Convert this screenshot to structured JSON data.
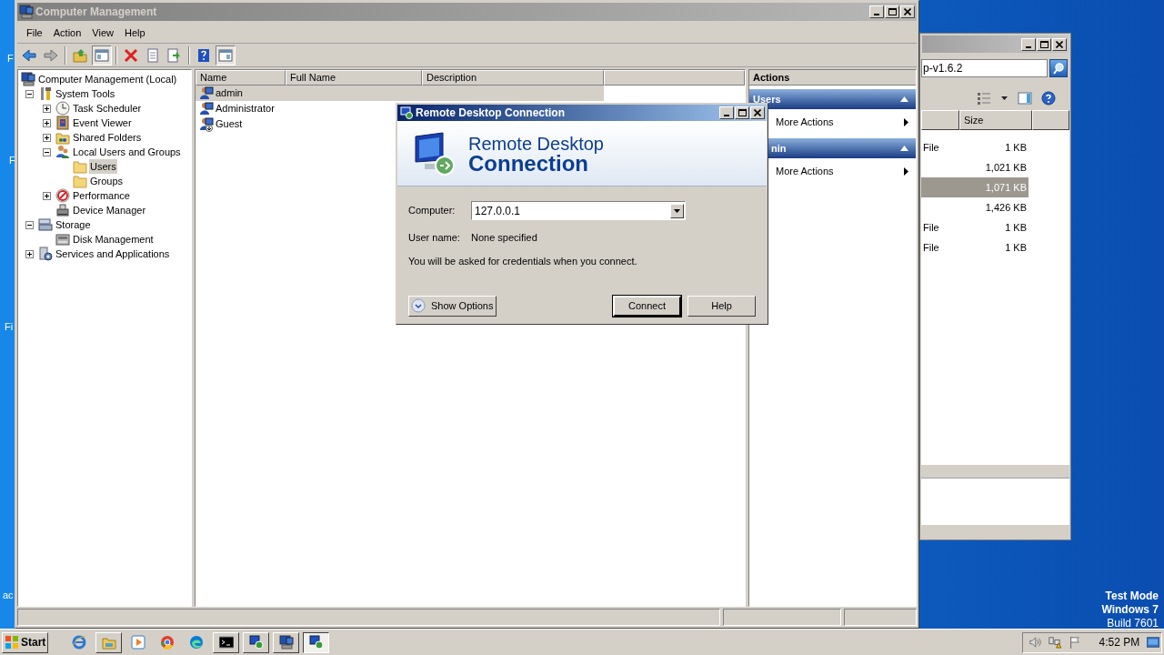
{
  "desktop": {
    "icon_label_fragments": [
      "F",
      "F",
      "Fi",
      "ac"
    ],
    "os_notice": [
      "Test Mode",
      "Windows 7",
      "Build 7601"
    ]
  },
  "computer_management": {
    "title": "Computer Management",
    "menu": [
      "File",
      "Action",
      "View",
      "Help"
    ],
    "toolbar": [
      {
        "pressed": false
      },
      {
        "pressed": false
      },
      {
        "pressed": false
      },
      {
        "pressed": true
      },
      {
        "pressed": false
      },
      {
        "pressed": false
      },
      {
        "pressed": false
      },
      {
        "pressed": false
      },
      {
        "pressed": true
      }
    ],
    "tree": [
      {
        "label": "Computer Management (Local)",
        "selected": false,
        "children": [
          {
            "label": "System Tools",
            "expanded": true,
            "selected": false,
            "children": [
              {
                "label": "Task Scheduler",
                "expanded": false,
                "selected": false
              },
              {
                "label": "Event Viewer",
                "expanded": false,
                "selected": false
              },
              {
                "label": "Shared Folders",
                "expanded": false,
                "selected": false
              },
              {
                "label": "Local Users and Groups",
                "expanded": true,
                "selected": false,
                "children": [
                  {
                    "label": "Users",
                    "selected": true
                  },
                  {
                    "label": "Groups",
                    "selected": false
                  }
                ]
              },
              {
                "label": "Performance",
                "expanded": false,
                "selected": false
              },
              {
                "label": "Device Manager",
                "selected": false
              }
            ]
          },
          {
            "label": "Storage",
            "expanded": true,
            "selected": false,
            "children": [
              {
                "label": "Disk Management",
                "selected": false
              }
            ]
          },
          {
            "label": "Services and Applications",
            "expanded": false,
            "selected": false
          }
        ]
      }
    ],
    "list": {
      "columns": [
        "Name",
        "Full Name",
        "Description"
      ],
      "rows": [
        {
          "name": "admin",
          "selected": true,
          "disabled": false
        },
        {
          "name": "Administrator",
          "selected": false,
          "disabled": false
        },
        {
          "name": "Guest",
          "selected": false,
          "disabled": true
        }
      ]
    },
    "actions": {
      "title": "Actions",
      "sections": [
        {
          "title": "Users",
          "items": [
            "More Actions"
          ]
        },
        {
          "title": "nin",
          "items": [
            "More Actions"
          ]
        }
      ]
    }
  },
  "explorer": {
    "address": "p-v1.6.2",
    "columns": [
      "Size"
    ],
    "rows": [
      {
        "type": "File",
        "size": "1 KB",
        "selected": false
      },
      {
        "size": "1,021 KB",
        "selected": false
      },
      {
        "size": "1,071 KB",
        "selected": true
      },
      {
        "size": "1,426 KB",
        "selected": false
      },
      {
        "type": "File",
        "size": "1 KB",
        "selected": false
      },
      {
        "type": "File",
        "size": "1 KB",
        "selected": false
      }
    ]
  },
  "rdc": {
    "title": "Remote Desktop Connection",
    "heading": [
      "Remote Desktop",
      "Connection"
    ],
    "computer_label": "Computer:",
    "computer_value": "127.0.0.1",
    "user_label": "User name:",
    "user_value": "None specified",
    "note": "You will be asked for credentials when you connect.",
    "buttons": [
      {
        "label": "Show Options",
        "kind": "options"
      },
      {
        "label": "Connect",
        "kind": "default"
      },
      {
        "label": "Help",
        "kind": "plain"
      }
    ]
  },
  "taskbar": {
    "start": "Start",
    "apps": [
      {
        "kind": "launcher"
      },
      {
        "kind": "window",
        "active": false
      },
      {
        "kind": "launcher"
      },
      {
        "kind": "launcher"
      },
      {
        "kind": "launcher"
      },
      {
        "kind": "window",
        "active": false
      },
      {
        "kind": "window",
        "active": false
      },
      {
        "kind": "window",
        "active": false
      },
      {
        "kind": "window",
        "active": true
      }
    ],
    "clock": "4:52 PM"
  }
}
